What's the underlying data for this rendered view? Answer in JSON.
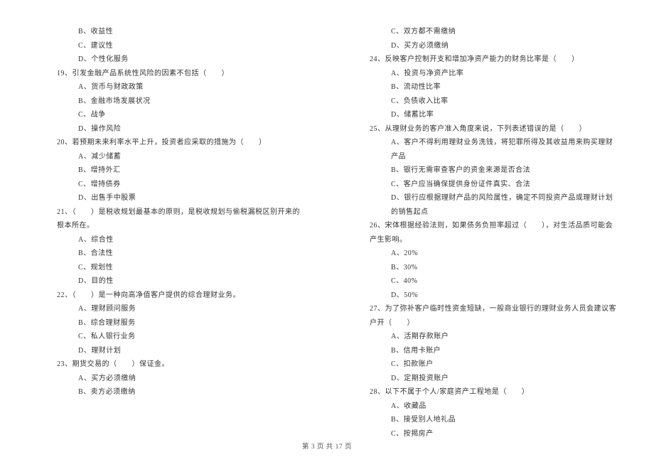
{
  "col1": {
    "opts18": [
      "B、收益性",
      "C、建议性",
      "D、个性化服务"
    ],
    "q19": "19、引发金融产品系统性风险的因素不包括（　　）",
    "opts19": [
      "A、货币与财政政策",
      "B、金融市场发展状况",
      "C、战争",
      "D、操作风险"
    ],
    "q20": "20、若预期未来利率水平上升，投资者应采取的措施为（　　）",
    "opts20": [
      "A、减少储蓄",
      "B、增持外汇",
      "C、增持债券",
      "D、出售手中股票"
    ],
    "q21": "21、（　　）是税收规划最基本的原则，是税收规划与偷税漏税区别开来的根本所在。",
    "opts21": [
      "A、综合性",
      "B、合法性",
      "C、规划性",
      "D、目的性"
    ],
    "q22": "22、（　　）是一种向高净值客户提供的综合理财业务。",
    "opts22": [
      "A、理财顾问服务",
      "B、综合理财服务",
      "C、私人银行业务",
      "D、理财计划"
    ],
    "q23": "23、期货交易的（　　）保证金。",
    "opts23": [
      "A、买方必须缴纳",
      "B、卖方必须缴纳"
    ]
  },
  "col2": {
    "opts23b": [
      "C、双方都不需缴纳",
      "D、买方必须缴纳"
    ],
    "q24": "24、反映客户控制开支和增加净资产能力的财务比率是（　　）",
    "opts24": [
      "A、投资与净资产比率",
      "B、流动性比率",
      "C、负债收入比率",
      "D、储蓄比率"
    ],
    "q25": "25、从理财业务的客户准入角度来说，下列表述错误的是（　　）",
    "opts25": [
      "A、客户不得利用理财业务洗钱，将犯罪所得及其收益用来购买理财产品",
      "B、银行无需审查客户的资金来源是否合法",
      "C、客户应当确保提供身份证件真实、合法",
      "D、银行应根据理财产品的风险属性，确定不同投资产品或理财计划的销售起点"
    ],
    "q26": "26、宋体根据经验法则，如果债务负担率超过（　　），对生活品质可能会产生影响。",
    "opts26": [
      "A、20%",
      "B、30%",
      "C、40%",
      "D、50%"
    ],
    "q27": "27、为了弥补客户临时性资金短缺，一般商业银行的理财业务人员会建议客户开（　　）",
    "opts27": [
      "A、活期存款账户",
      "B、信用卡账户",
      "C、扣款账户",
      "D、定期投资账户"
    ],
    "q28": "28、以下不属于个人/家庭资产工程地是（　　）",
    "opts28": [
      "A、收藏品",
      "B、接受别人地礼品",
      "C、按揭房产"
    ]
  },
  "footer": "第 3 页 共 17 页"
}
